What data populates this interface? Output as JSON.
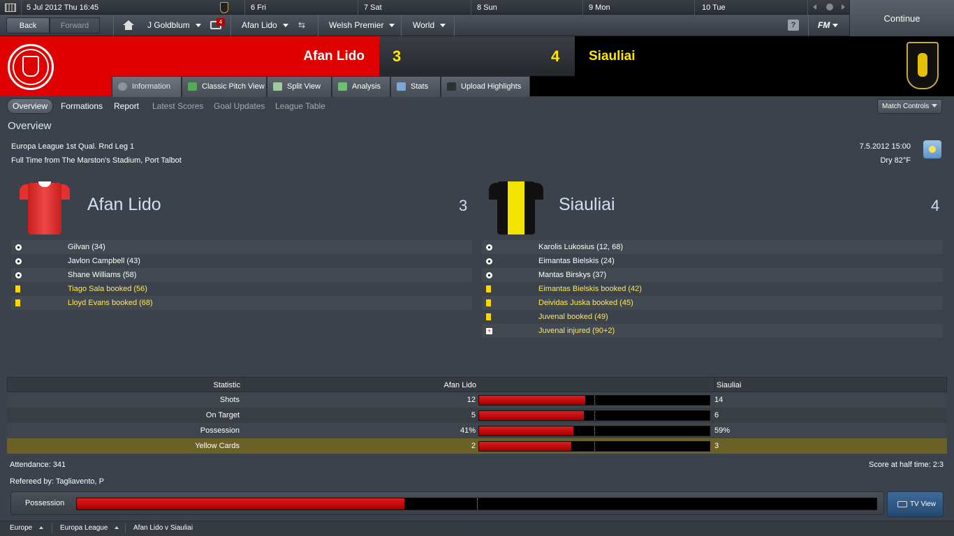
{
  "calendar": {
    "date_label": "5 Jul 2012 Thu 16:45",
    "days": [
      "6 Fri",
      "7 Sat",
      "8 Sun",
      "9 Mon",
      "10 Tue"
    ]
  },
  "nav": {
    "back_label": "Back",
    "forward_label": "Forward",
    "manager": "J Goldblum",
    "inbox_count": "4",
    "club": "Afan Lido",
    "league": "Welsh Premier",
    "world": "World",
    "help": "?",
    "fm_label": "FM",
    "continue_label": "Continue"
  },
  "header": {
    "home_team": "Afan Lido",
    "home_score": "3",
    "away_score": "4",
    "away_team": "Siauliai",
    "home_color": "#e00000"
  },
  "tabs": [
    {
      "label": "Information",
      "icon": "info-icon"
    },
    {
      "label": "Classic Pitch View",
      "icon": "pitch-icon"
    },
    {
      "label": "Split View",
      "icon": "split-icon"
    },
    {
      "label": "Analysis",
      "icon": "analysis-icon"
    },
    {
      "label": "Stats",
      "icon": "stats-icon"
    },
    {
      "label": "Upload Highlights",
      "icon": "camera-icon"
    }
  ],
  "subnav": {
    "items": [
      "Overview",
      "Formations",
      "Report",
      "Latest Scores",
      "Goal Updates",
      "League Table"
    ],
    "match_controls": "Match Controls"
  },
  "overview": {
    "title": "Overview",
    "competition": "Europa League 1st Qual. Rnd Leg 1",
    "venue": "Full Time from The Marston's Stadium, Port Talbot",
    "datetime": "7.5.2012 15:00",
    "weather": "Dry 82°F",
    "home": {
      "name": "Afan Lido",
      "score": "3",
      "events": [
        {
          "type": "goal",
          "text": "Gilvan (34)"
        },
        {
          "type": "goal",
          "text": "Javlon Campbell (43)"
        },
        {
          "type": "goal",
          "text": "Shane Williams (58)"
        },
        {
          "type": "booking",
          "text": "Tiago Sala booked (56)"
        },
        {
          "type": "booking",
          "text": "Lloyd Evans booked (68)"
        }
      ]
    },
    "away": {
      "name": "Siauliai",
      "score": "4",
      "events": [
        {
          "type": "goal",
          "text": "Karolis Lukosius (12, 68)"
        },
        {
          "type": "goal",
          "text": "Eimantas Bielskis (24)"
        },
        {
          "type": "goal",
          "text": "Mantas Birskys (37)"
        },
        {
          "type": "booking",
          "text": "Eimantas Bielskis booked (42)"
        },
        {
          "type": "booking",
          "text": "Deividas Juska booked (45)"
        },
        {
          "type": "booking",
          "text": "Juvenal booked (49)"
        },
        {
          "type": "injury",
          "text": "Juvenal injured (90+2)"
        }
      ]
    }
  },
  "stats": {
    "header": {
      "stat": "Statistic",
      "home": "Afan Lido",
      "away": "Siauliai"
    },
    "rows": [
      {
        "name": "Shots",
        "home": "12",
        "away": "14",
        "home_share": 0.4615
      },
      {
        "name": "On Target",
        "home": "5",
        "away": "6",
        "home_share": 0.4545
      },
      {
        "name": "Possession",
        "home": "41%",
        "away": "59%",
        "home_share": 0.41
      },
      {
        "name": "Yellow Cards",
        "home": "2",
        "away": "3",
        "home_share": 0.4
      }
    ]
  },
  "footer_info": {
    "attendance": "Attendance: 341",
    "halftime": "Score at half time: 2:3",
    "referee": "Refereed by: Tagliavento, P",
    "possession_label": "Possession",
    "possession_home_share": 0.41,
    "tv_view": "TV View"
  },
  "breadcrumbs": [
    "Europe",
    "Europa League",
    "Afan Lido v Siauliai"
  ]
}
